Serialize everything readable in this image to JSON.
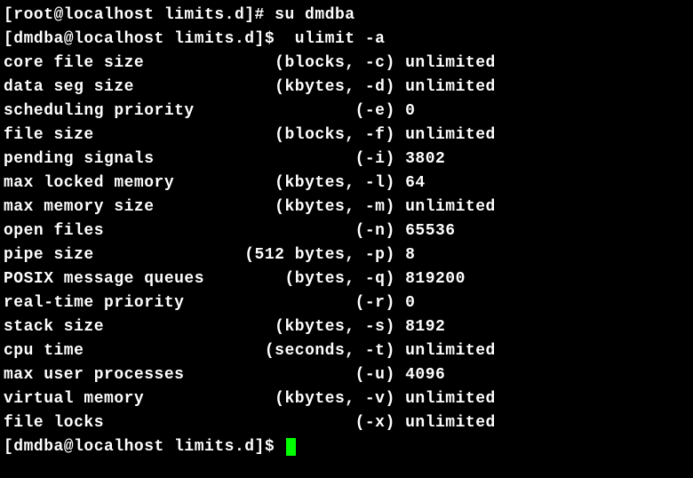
{
  "prompt1": {
    "user": "root",
    "host": "localhost",
    "dir": "limits.d",
    "symbol": "#",
    "command": "su dmdba"
  },
  "prompt2": {
    "user": "dmdba",
    "host": "localhost",
    "dir": "limits.d",
    "symbol": "$",
    "command": "ulimit -a"
  },
  "prompt3": {
    "user": "dmdba",
    "host": "localhost",
    "dir": "limits.d",
    "symbol": "$",
    "command": ""
  },
  "limits": [
    {
      "name": "core file size",
      "spec": "(blocks, -c)",
      "value": "unlimited"
    },
    {
      "name": "data seg size",
      "spec": "(kbytes, -d)",
      "value": "unlimited"
    },
    {
      "name": "scheduling priority",
      "spec": "(-e)",
      "value": "0"
    },
    {
      "name": "file size",
      "spec": "(blocks, -f)",
      "value": "unlimited"
    },
    {
      "name": "pending signals",
      "spec": "(-i)",
      "value": "3802"
    },
    {
      "name": "max locked memory",
      "spec": "(kbytes, -l)",
      "value": "64"
    },
    {
      "name": "max memory size",
      "spec": "(kbytes, -m)",
      "value": "unlimited"
    },
    {
      "name": "open files",
      "spec": "(-n)",
      "value": "65536"
    },
    {
      "name": "pipe size",
      "spec": "(512 bytes, -p)",
      "value": "8"
    },
    {
      "name": "POSIX message queues",
      "spec": "(bytes, -q)",
      "value": "819200"
    },
    {
      "name": "real-time priority",
      "spec": "(-r)",
      "value": "0"
    },
    {
      "name": "stack size",
      "spec": "(kbytes, -s)",
      "value": "8192"
    },
    {
      "name": "cpu time",
      "spec": "(seconds, -t)",
      "value": "unlimited"
    },
    {
      "name": "max user processes",
      "spec": "(-u)",
      "value": "4096"
    },
    {
      "name": "virtual memory",
      "spec": "(kbytes, -v)",
      "value": "unlimited"
    },
    {
      "name": "file locks",
      "spec": "(-x)",
      "value": "unlimited"
    }
  ]
}
